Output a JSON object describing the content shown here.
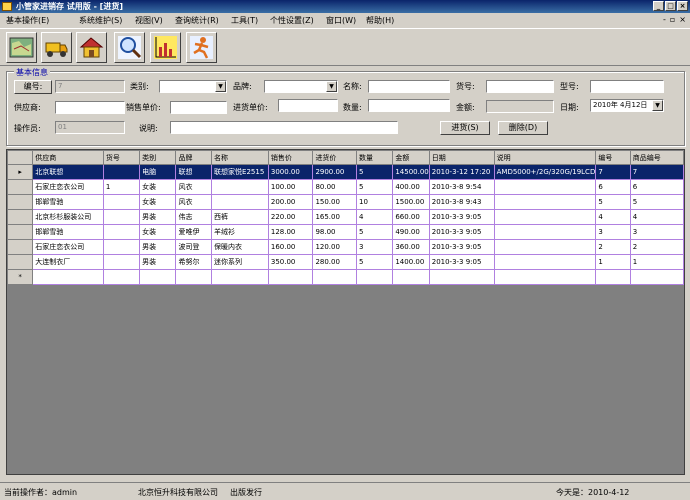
{
  "window": {
    "title": "小管家进销存  试用版 - [进货]",
    "minimize": "_",
    "maximize": "□",
    "close": "×"
  },
  "menu": {
    "items": [
      "基本操作(E)",
      "系统维护(S)",
      "视图(V)",
      "查询统计(R)",
      "工具(T)",
      "个性设置(Z)",
      "窗口(W)",
      "帮助(H)"
    ],
    "mdi_minimize": "-",
    "mdi_restore": "▫",
    "mdi_close": "×"
  },
  "toolbar": {
    "icons": [
      "map-icon",
      "truck-icon",
      "house-icon",
      "magnifier-icon",
      "bar-chart-icon",
      "exit-runner-icon"
    ]
  },
  "form": {
    "group_title": "基本信息",
    "id_button": "编号:",
    "id_value": "7",
    "category_label": "类别:",
    "category_value": "",
    "brand_label": "品牌:",
    "brand_value": "",
    "name_label": "名称:",
    "name_value": "",
    "sku_label": "货号:",
    "sku_value": "",
    "model_label": "型号:",
    "model_value": "",
    "supplier_label": "供应商:",
    "supplier_value": "",
    "sale_price_label": "销售单价:",
    "sale_price_value": "",
    "purchase_price_label": "进货单价:",
    "purchase_price_value": "",
    "quantity_label": "数量:",
    "quantity_value": "",
    "amount_label": "金额:",
    "amount_value": "",
    "date_label": "日期:",
    "date_value": "2010年 4月12日",
    "operator_label": "操作员:",
    "operator_value": "01",
    "note_label": "说明:",
    "note_value": "",
    "stock_in_button": "进货(S)",
    "delete_button": "删除(D)"
  },
  "grid": {
    "columns": [
      "供应商",
      "货号",
      "类别",
      "品牌",
      "名称",
      "销售价",
      "进货价",
      "数量",
      "金额",
      "日期",
      "说明",
      "编号",
      "商品编号"
    ],
    "rows": [
      [
        "北京联想",
        "",
        "电脑",
        "联想",
        "联想家悦E2515",
        "3000.00",
        "2900.00",
        "5",
        "14500.00",
        "2010-3-12 17:20",
        "AMD5000+/2G/320G/19LCD",
        "7",
        "7"
      ],
      [
        "石家庄恋衣公司",
        "1",
        "女装",
        "风衣",
        "",
        "100.00",
        "80.00",
        "5",
        "400.00",
        "2010-3-8 9:54",
        "",
        "6",
        "6"
      ],
      [
        "邯郸雪驰",
        "",
        "女装",
        "风衣",
        "",
        "200.00",
        "150.00",
        "10",
        "1500.00",
        "2010-3-8 9:43",
        "",
        "5",
        "5"
      ],
      [
        "北京杉杉服装公司",
        "",
        "男装",
        "伟志",
        "西裤",
        "220.00",
        "165.00",
        "4",
        "660.00",
        "2010-3-3 9:05",
        "",
        "4",
        "4"
      ],
      [
        "邯郸雪驰",
        "",
        "女装",
        "爱唯伊",
        "羊绒衫",
        "128.00",
        "98.00",
        "5",
        "490.00",
        "2010-3-3 9:05",
        "",
        "3",
        "3"
      ],
      [
        "石家庄恋衣公司",
        "",
        "男装",
        "波司登",
        "保暖内衣",
        "160.00",
        "120.00",
        "3",
        "360.00",
        "2010-3-3 9:05",
        "",
        "2",
        "2"
      ],
      [
        "大连制衣厂",
        "",
        "男装",
        "希努尔",
        "迷你系列",
        "350.00",
        "280.00",
        "5",
        "1400.00",
        "2010-3-3 9:05",
        "",
        "1",
        "1"
      ]
    ],
    "current_row_marker": "▸",
    "new_row_marker": "*"
  },
  "status": {
    "operator": "当前操作者：admin",
    "company": "北京恒升科技有限公司",
    "publisher": "出版发行",
    "today": "今天是：2010-4-12"
  },
  "colors": {
    "selection": "#0a246a",
    "title_bar": "#0a246a",
    "grid_lines": "#b080e0"
  }
}
